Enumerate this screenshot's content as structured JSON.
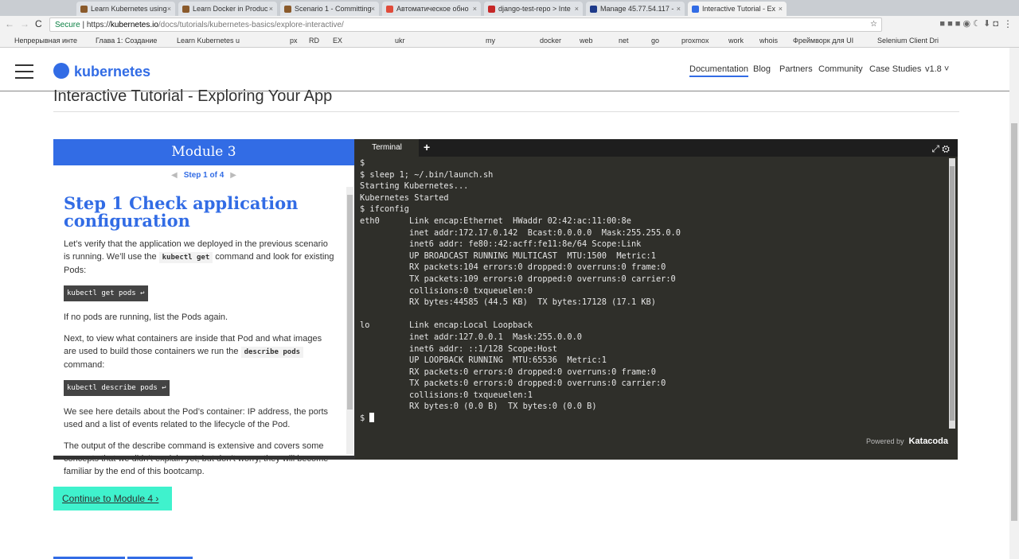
{
  "browser": {
    "tabs": [
      "Learn Kubernetes using",
      "Learn Docker in Produc",
      "Scenario 1 - Committing",
      "Автоматическое обно",
      "django-test-repo > Inte",
      "Manage 45.77.54.117 -",
      "Interactive Tutorial - Ex"
    ],
    "tab_colors": [
      "#8a5a2b",
      "#8a5a2b",
      "#8a5a2b",
      "#e04b3a",
      "#c62828",
      "#1e3a8a",
      "#326ce5"
    ],
    "secure": "Secure",
    "url_scheme": "https://",
    "url_host": "kubernetes.io",
    "url_path": "/docs/tutorials/kubernetes-basics/explore-interactive/",
    "bookmarks": [
      "Непрерывная инте",
      "Глава 1: Создание",
      "Learn Kubernetes u",
      "px",
      "RD",
      "EX",
      "ukr",
      "my",
      "docker",
      "web",
      "net",
      "go",
      "proxmox",
      "work",
      "whois",
      "Фреймворк для UI",
      "Selenium Client Dri"
    ]
  },
  "site": {
    "logo": "kubernetes",
    "nav": [
      "Documentation",
      "Blog",
      "Partners",
      "Community",
      "Case Studies",
      "v1.8 ˅"
    ],
    "page_title": "Interactive Tutorial - Exploring Your App"
  },
  "module": {
    "title": "Module 3",
    "step": "Step 1 of 4",
    "heading": "Step 1 Check application configuration",
    "p1a": "Let’s verify that the application we deployed in the previous scenario is running. We’ll use the ",
    "p1code": "kubectl get",
    "p1b": " command and look for existing Pods:",
    "cmd1": "kubectl get pods ↩",
    "p2": "If no pods are running, list the Pods again.",
    "p3a": "Next, to view what containers are inside that Pod and what images are used to build those containers we run the ",
    "p3code": "describe pods",
    "p3b": " command:",
    "cmd2": "kubectl describe pods ↩",
    "p4": "We see here details about the Pod’s container: IP address, the ports used and a list of events related to the lifecycle of the Pod.",
    "p5": "The output of the describe command is extensive and covers some concepts that we didn’t explain yet, but don’t worry, they will become familiar by the end of this bootcamp."
  },
  "terminal": {
    "tab": "Terminal",
    "output": "$\n$ sleep 1; ~/.bin/launch.sh\nStarting Kubernetes...\nKubernetes Started\n$ ifconfig\neth0      Link encap:Ethernet  HWaddr 02:42:ac:11:00:8e\n          inet addr:172.17.0.142  Bcast:0.0.0.0  Mask:255.255.0.0\n          inet6 addr: fe80::42:acff:fe11:8e/64 Scope:Link\n          UP BROADCAST RUNNING MULTICAST  MTU:1500  Metric:1\n          RX packets:104 errors:0 dropped:0 overruns:0 frame:0\n          TX packets:109 errors:0 dropped:0 overruns:0 carrier:0\n          collisions:0 txqueuelen:0\n          RX bytes:44585 (44.5 KB)  TX bytes:17128 (17.1 KB)\n\nlo        Link encap:Local Loopback\n          inet addr:127.0.0.1  Mask:255.0.0.0\n          inet6 addr: ::1/128 Scope:Host\n          UP LOOPBACK RUNNING  MTU:65536  Metric:1\n          RX packets:0 errors:0 dropped:0 overruns:0 frame:0\n          TX packets:0 errors:0 dropped:0 overruns:0 carrier:0\n          collisions:0 txqueuelen:1\n          RX bytes:0 (0.0 B)  TX bytes:0 (0.0 B)\n",
    "prompt": "$ ",
    "powered_by": "Powered by",
    "brand": "Katacoda"
  },
  "continue": "Continue to Module 4 ›"
}
